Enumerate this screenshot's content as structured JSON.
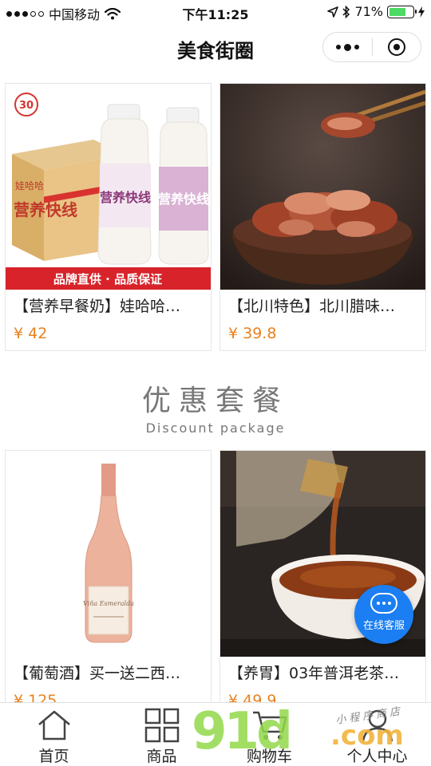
{
  "status_bar": {
    "carrier": "中国移动",
    "time": "下午11:25",
    "battery_text": "71%",
    "battery_level": 0.71
  },
  "nav": {
    "title": "美食街圈"
  },
  "products_top": [
    {
      "title": "【营养早餐奶】娃哈哈…",
      "price": "¥ 42",
      "image": {
        "bottle_label": "营养快线",
        "box_label": "营养快线",
        "box_brand": "娃哈哈",
        "banner": "品牌直供 · 品质保证",
        "badge": "30"
      }
    },
    {
      "title": "【北川特色】北川腊味…",
      "price": "¥ 39.8"
    }
  ],
  "section": {
    "title_cn": "优惠套餐",
    "title_en": "Discount package"
  },
  "products_bottom": [
    {
      "title": "【葡萄酒】买一送二西…",
      "price": "¥ 125",
      "image": {
        "wine_label": "Viña Esmeralda"
      }
    },
    {
      "title": "【养胃】03年普洱老茶…",
      "price": "¥ 49.9"
    }
  ],
  "customer_service": {
    "label": "在线客服"
  },
  "tabs": [
    {
      "label": "首页",
      "icon": "home-icon"
    },
    {
      "label": "商品",
      "icon": "grid-icon"
    },
    {
      "label": "购物车",
      "icon": "cart-icon"
    },
    {
      "label": "个人中心",
      "icon": "user-icon"
    }
  ],
  "watermark": {
    "brand": "91",
    "brand_mid": "d",
    "domain_suffix": ".com",
    "script": "小程序商店"
  },
  "colors": {
    "price": "#e8811f",
    "service_button": "#1b7ef2",
    "battery": "#4cd964"
  }
}
